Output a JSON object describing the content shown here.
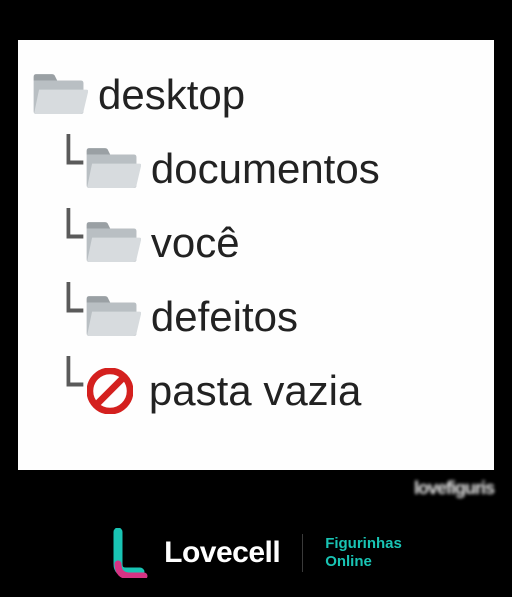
{
  "tree": {
    "root": {
      "label": "desktop",
      "icon": "folder-open"
    },
    "children": [
      {
        "label": "documentos",
        "icon": "folder-open"
      },
      {
        "label": "você",
        "icon": "folder-open"
      },
      {
        "label": "defeitos",
        "icon": "folder-open"
      },
      {
        "label": "pasta vazia",
        "icon": "prohibited"
      }
    ]
  },
  "footer": {
    "brand": "Lovecell",
    "tagline_line1": "Figurinhas",
    "tagline_line2": "Online"
  },
  "watermark": "lovefiguris",
  "colors": {
    "folder_fill": "#b9bfc3",
    "folder_tab": "#9aa0a4",
    "folder_front": "#d7dbde",
    "prohibit": "#d4201e",
    "brand_teal": "#19c4b4",
    "brand_magenta": "#d63384"
  }
}
